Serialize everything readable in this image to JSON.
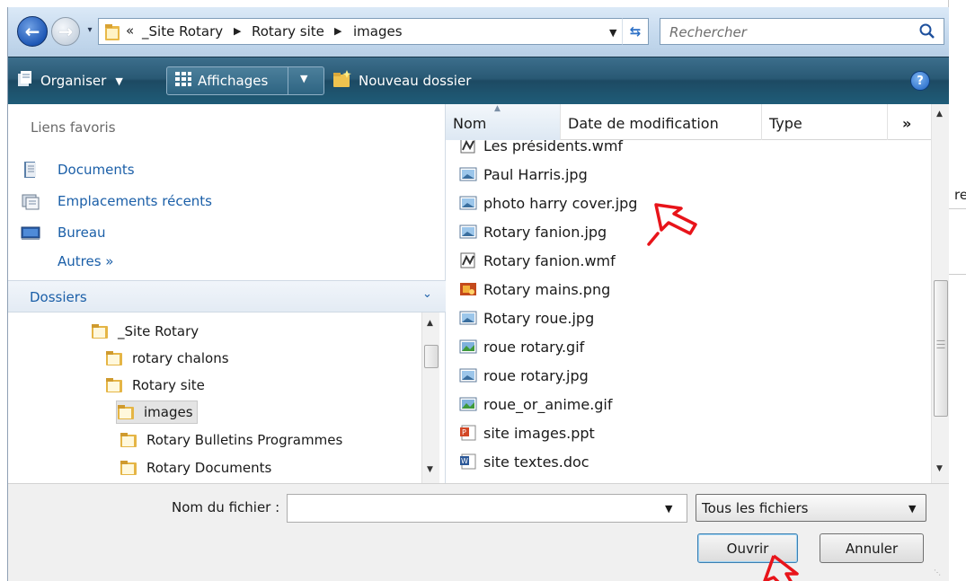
{
  "addressbar": {
    "history_dropdown": "▾",
    "overflow": "«",
    "crumbs": [
      "_Site Rotary",
      "Rotary site",
      "images"
    ],
    "search_placeholder": "Rechercher"
  },
  "toolbar": {
    "organize": "Organiser",
    "views": "Affichages",
    "new_folder": "Nouveau dossier",
    "help": "?"
  },
  "favorites": {
    "title": "Liens favoris",
    "items": [
      {
        "label": "Documents",
        "icon": "documents-icon"
      },
      {
        "label": "Emplacements récents",
        "icon": "recent-places-icon"
      },
      {
        "label": "Bureau",
        "icon": "desktop-icon"
      }
    ],
    "more": "Autres »"
  },
  "folders": {
    "title": "Dossiers",
    "tree": [
      {
        "label": "_Site Rotary",
        "selected": false
      },
      {
        "label": "rotary chalons",
        "selected": false
      },
      {
        "label": "Rotary site",
        "selected": false
      },
      {
        "label": "images",
        "selected": true
      },
      {
        "label": "Rotary Bulletins Programmes",
        "selected": false
      },
      {
        "label": "Rotary Documents",
        "selected": false
      }
    ]
  },
  "filelist": {
    "columns": [
      "Nom",
      "Date de modification",
      "Type",
      "»"
    ],
    "files": [
      {
        "name": "Les présidents.wmf",
        "icon": "wmf-file-icon"
      },
      {
        "name": "Paul Harris.jpg",
        "icon": "jpg-file-icon"
      },
      {
        "name": "photo harry cover.jpg",
        "icon": "jpg-file-icon"
      },
      {
        "name": "Rotary fanion.jpg",
        "icon": "jpg-file-icon"
      },
      {
        "name": "Rotary fanion.wmf",
        "icon": "wmf-file-icon"
      },
      {
        "name": "Rotary mains.png",
        "icon": "png-file-icon"
      },
      {
        "name": "Rotary roue.jpg",
        "icon": "jpg-file-icon"
      },
      {
        "name": "roue rotary.gif",
        "icon": "gif-file-icon"
      },
      {
        "name": "roue rotary.jpg",
        "icon": "jpg-file-icon"
      },
      {
        "name": "roue_or_anime.gif",
        "icon": "gif-file-icon"
      },
      {
        "name": "site images.ppt",
        "icon": "ppt-file-icon"
      },
      {
        "name": "site textes.doc",
        "icon": "doc-file-icon"
      }
    ]
  },
  "bottom": {
    "filename_label": "Nom du fichier :",
    "filename_value": "",
    "filetype": "Tous les fichiers",
    "open": "Ouvrir",
    "cancel": "Annuler"
  },
  "colors": {
    "toolbar": "#295974",
    "link": "#1b5fa8",
    "annotation": "#e8141a"
  }
}
